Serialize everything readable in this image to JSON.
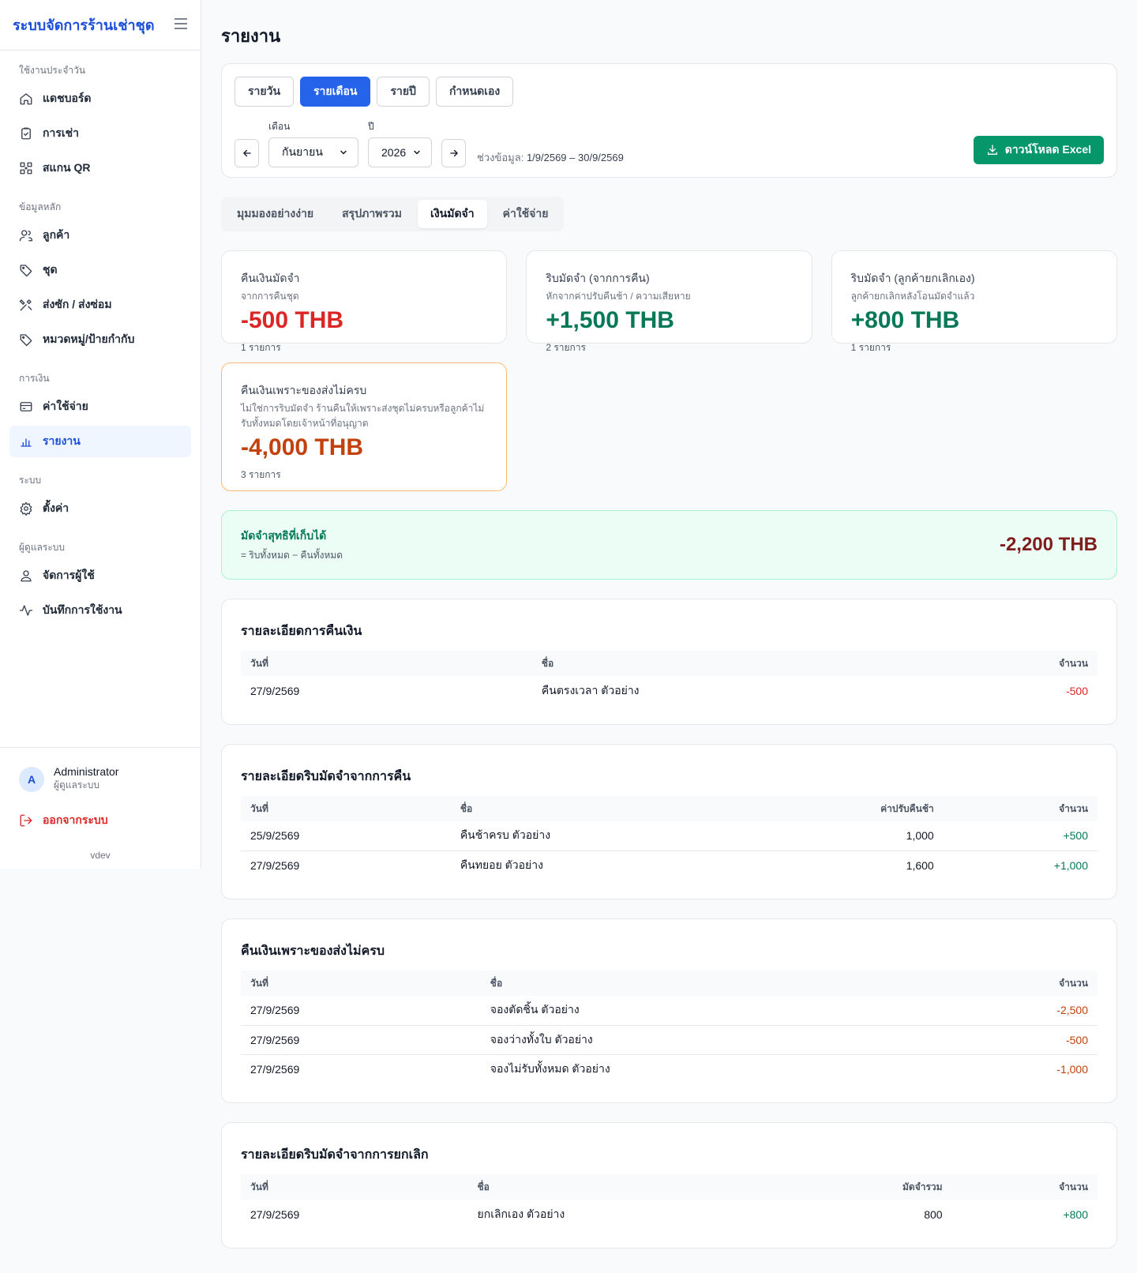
{
  "sidebar": {
    "brand": "ระบบจัดการร้านเช่าชุด",
    "sections": [
      {
        "heading": "ใช้งานประจำวัน",
        "items": [
          {
            "label": "แดชบอร์ด",
            "icon": "home-icon"
          },
          {
            "label": "การเช่า",
            "icon": "clipboard-icon"
          },
          {
            "label": "สแกน QR",
            "icon": "qr-icon"
          }
        ]
      },
      {
        "heading": "ข้อมูลหลัก",
        "items": [
          {
            "label": "ลูกค้า",
            "icon": "users-icon"
          },
          {
            "label": "ชุด",
            "icon": "tag-icon"
          },
          {
            "label": "ส่งซัก / ส่งซ่อม",
            "icon": "tools-icon"
          },
          {
            "label": "หมวดหมู่/ป้ายกำกับ",
            "icon": "label-icon"
          }
        ]
      },
      {
        "heading": "การเงิน",
        "items": [
          {
            "label": "ค่าใช้จ่าย",
            "icon": "credit-card-icon"
          },
          {
            "label": "รายงาน",
            "icon": "bar-chart-icon",
            "active": true
          }
        ]
      },
      {
        "heading": "ระบบ",
        "items": [
          {
            "label": "ตั้งค่า",
            "icon": "gear-icon"
          }
        ]
      },
      {
        "heading": "ผู้ดูแลระบบ",
        "items": [
          {
            "label": "จัดการผู้ใช้",
            "icon": "user-icon"
          },
          {
            "label": "บันทึกการใช้งาน",
            "icon": "activity-icon"
          }
        ]
      }
    ],
    "user": {
      "initial": "A",
      "name": "Administrator",
      "role": "ผู้ดูแลระบบ"
    },
    "logout": "ออกจากระบบ",
    "version": "vdev"
  },
  "page": {
    "title": "รายงาน"
  },
  "filters": {
    "periods": [
      "รายวัน",
      "รายเดือน",
      "รายปี",
      "กำหนดเอง"
    ],
    "active_period": "รายเดือน",
    "month_label": "เดือน",
    "month_value": "กันยายน",
    "year_label": "ปี",
    "year_value": "2026",
    "range_label": "ช่วงข้อมูล:",
    "range_value": "1/9/2569 – 30/9/2569",
    "download_label": "ดาวน์โหลด Excel"
  },
  "view_tabs": [
    "มุมมองอย่างง่าย",
    "สรุปภาพรวม",
    "เงินมัดจำ",
    "ค่าใช้จ่าย"
  ],
  "active_view": "เงินมัดจำ",
  "stats": [
    {
      "label": "คืนเงินมัดจำ",
      "sub": "จากการคืนชุด",
      "value": "-500 THB",
      "count": "1 รายการ",
      "color": "#dc2626"
    },
    {
      "label": "ริบมัดจำ (จากการคืน)",
      "sub": "หักจากค่าปรับคืนช้า / ความเสียหาย",
      "value": "+1,500 THB",
      "count": "2 รายการ",
      "color": "#047857"
    },
    {
      "label": "ริบมัดจำ (ลูกค้ายกเลิกเอง)",
      "sub": "ลูกค้ายกเลิกหลังโอนมัดจำแล้ว",
      "value": "+800 THB",
      "count": "1 รายการ",
      "color": "#047857"
    }
  ],
  "shortage_stat": {
    "label": "คืนเงินเพราะของส่งไม่ครบ",
    "sub": "ไม่ใช่การริบมัดจำ ร้านคืนให้เพราะส่งชุดไม่ครบหรือลูกค้าไม่รับทั้งหมดโดยเจ้าหน้าที่อนุญาต",
    "value": "-4,000 THB",
    "count": "3 รายการ",
    "color": "#c2410c"
  },
  "net": {
    "title": "มัดจำสุทธิที่เก็บได้",
    "sub": "= ริบทั้งหมด − คืนทั้งหมด",
    "value": "-2,200 THB"
  },
  "tables": {
    "refund": {
      "title": "รายละเอียดการคืนเงิน",
      "headers": [
        "วันที่",
        "ชื่อ",
        "จำนวน"
      ],
      "rows": [
        [
          "27/9/2569",
          "คืนตรงเวลา ตัวอย่าง",
          "-500"
        ]
      ]
    },
    "forfeit_return": {
      "title": "รายละเอียดริบมัดจำจากการคืน",
      "headers": [
        "วันที่",
        "ชื่อ",
        "ค่าปรับคืนช้า",
        "จำนวน"
      ],
      "rows": [
        [
          "25/9/2569",
          "คืนช้าครบ ตัวอย่าง",
          "1,000",
          "+500"
        ],
        [
          "27/9/2569",
          "คืนทยอย ตัวอย่าง",
          "1,600",
          "+1,000"
        ]
      ]
    },
    "shortage": {
      "title": "คืนเงินเพราะของส่งไม่ครบ",
      "headers": [
        "วันที่",
        "ชื่อ",
        "จำนวน"
      ],
      "rows": [
        [
          "27/9/2569",
          "จองตัดชิ้น ตัวอย่าง",
          "-2,500"
        ],
        [
          "27/9/2569",
          "จองว่างทั้งใบ ตัวอย่าง",
          "-500"
        ],
        [
          "27/9/2569",
          "จองไม่รับทั้งหมด ตัวอย่าง",
          "-1,000"
        ]
      ]
    },
    "forfeit_cancel": {
      "title": "รายละเอียดริบมัดจำจากการยกเลิก",
      "headers": [
        "วันที่",
        "ชื่อ",
        "มัดจำรวม",
        "จำนวน"
      ],
      "rows": [
        [
          "27/9/2569",
          "ยกเลิกเอง ตัวอย่าง",
          "800",
          "+800"
        ]
      ]
    }
  }
}
